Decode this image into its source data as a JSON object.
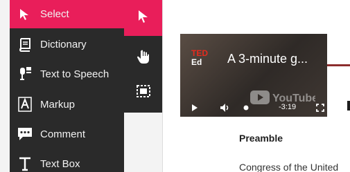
{
  "tool_menu": {
    "items": [
      {
        "label": "Select",
        "icon": "select-arrow-icon",
        "active": true
      },
      {
        "label": "Dictionary",
        "icon": "book-icon"
      },
      {
        "label": "Text to Speech",
        "icon": "speech-icon"
      },
      {
        "label": "Markup",
        "icon": "markup-icon"
      },
      {
        "label": "Comment",
        "icon": "comment-icon"
      },
      {
        "label": "Text Box",
        "icon": "text-box-icon"
      }
    ]
  },
  "toolbar": {
    "buttons": [
      {
        "icon": "select-arrow-icon",
        "active": true
      },
      {
        "icon": "hand-icon"
      },
      {
        "icon": "region-select-icon"
      }
    ]
  },
  "video": {
    "channel_logo_top": "TED",
    "channel_logo_bottom": "Ed",
    "title": "A 3-minute g...",
    "watermark": "YouTube",
    "time": "-3:19"
  },
  "document": {
    "heading": "Preamble",
    "body": "Congress of the United"
  },
  "colors": {
    "accent": "#e91e5a",
    "panel": "#2a2a2a"
  }
}
